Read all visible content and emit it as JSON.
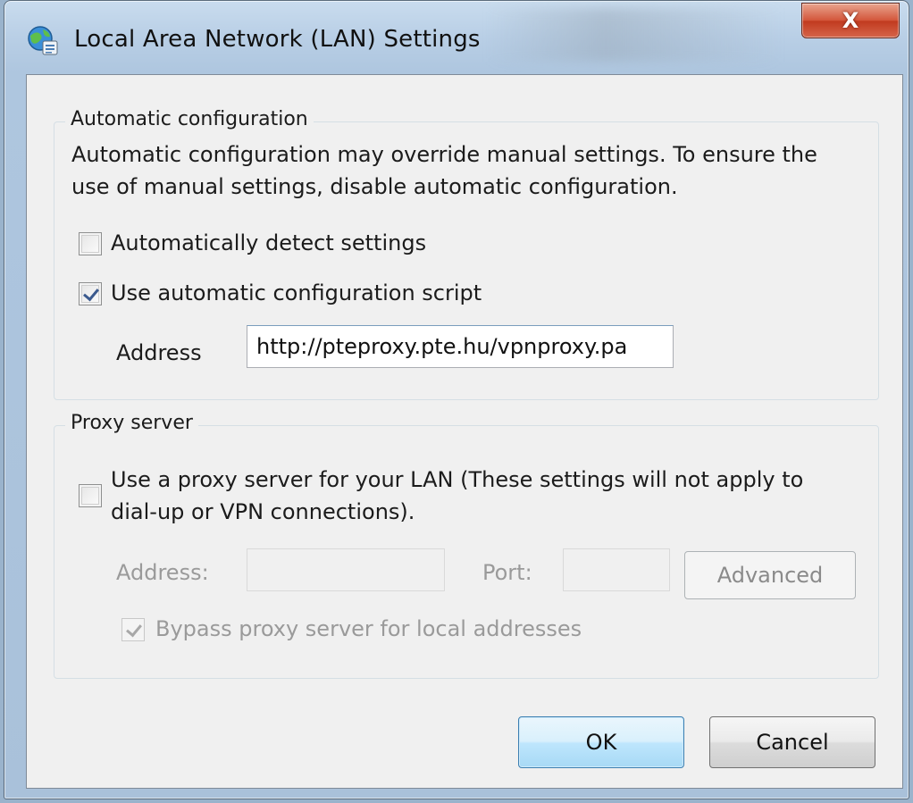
{
  "window": {
    "title": "Local Area Network (LAN) Settings",
    "close_glyph": "X",
    "icon": "network-settings-icon",
    "accent": "#c13a1f"
  },
  "auto_config": {
    "legend": "Automatic configuration",
    "description_line1": "Automatic configuration may override manual settings.  To ensure the",
    "description_line2": "use of manual settings, disable automatic configuration.",
    "detect_label": "Automatically detect settings",
    "detect_checked": false,
    "script_label": "Use automatic configuration script",
    "script_checked": true,
    "address_label": "Address",
    "address_value": "http://pteproxy.pte.hu/vpnproxy.pa"
  },
  "proxy": {
    "legend": "Proxy server",
    "use_proxy_line1": "Use a proxy server for your LAN (These settings will not apply to",
    "use_proxy_line2": "dial-up or VPN connections).",
    "use_proxy_checked": false,
    "address_label": "Address:",
    "address_value": "",
    "port_label": "Port:",
    "port_value": "",
    "advanced_label": "Advanced",
    "bypass_label": "Bypass proxy server for local addresses",
    "bypass_checked": true
  },
  "footer": {
    "ok_label": "OK",
    "cancel_label": "Cancel"
  }
}
